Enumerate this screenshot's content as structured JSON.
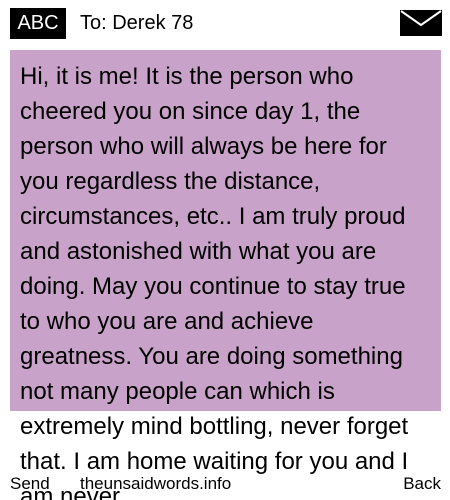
{
  "header": {
    "mode_label": "ABC",
    "recipient_label": "To: Derek 78"
  },
  "icons": {
    "message": "envelope-icon"
  },
  "message": {
    "text": "Hi, it is me! It is the person who cheered you on since day 1, the person who will always be here for you regardless the distance, circumstances, etc.. I am truly proud and astonished with what you are doing. May you continue to stay true to who you are and achieve greatness. You are doing something not many people can which is extremely mind bottling, never forget that. I am home waiting for you and I am never"
  },
  "footer": {
    "send_label": "Send",
    "site_label": "theunsaidwords.info",
    "back_label": "Back"
  },
  "colors": {
    "bubble": "#c8a2c8",
    "badge": "#000000",
    "text": "#000000"
  }
}
